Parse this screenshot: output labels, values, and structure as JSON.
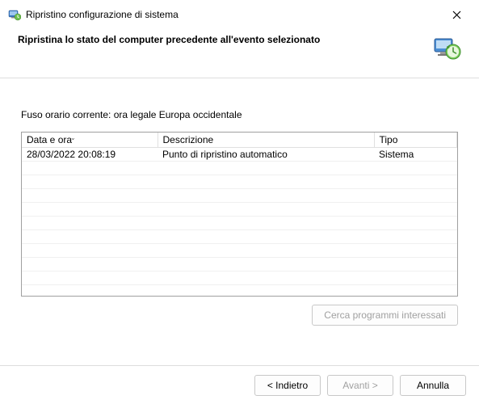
{
  "titlebar": {
    "title": "Ripristino configurazione di sistema"
  },
  "header": {
    "subtitle": "Ripristina lo stato del computer precedente all'evento selezionato"
  },
  "content": {
    "timezone_label": "Fuso orario corrente: ora legale Europa occidentale",
    "columns": {
      "date": "Data e ora",
      "description": "Descrizione",
      "type": "Tipo"
    },
    "rows": [
      {
        "date": "28/03/2022 20:08:19",
        "description": "Punto di ripristino automatico",
        "type": "Sistema"
      }
    ],
    "affected_programs_label": "Cerca programmi interessati"
  },
  "footer": {
    "back_label": "< Indietro",
    "next_label": "Avanti >",
    "cancel_label": "Annulla"
  }
}
